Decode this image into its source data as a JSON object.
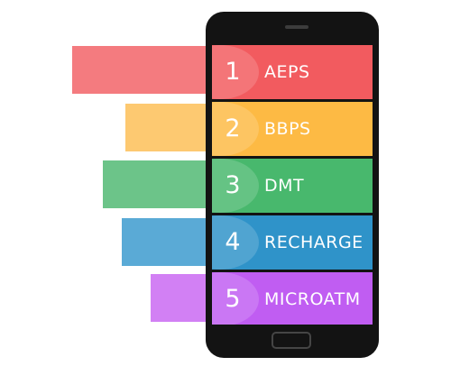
{
  "colors": {
    "aeps": "#f25b5f",
    "bbps": "#fdba44",
    "dmt": "#48b86d",
    "recharge": "#2f93c9",
    "microatm": "#c05df2",
    "phone_body": "#131313"
  },
  "menu": {
    "items": [
      {
        "number": "1",
        "label": "AEPS"
      },
      {
        "number": "2",
        "label": "BBPS"
      },
      {
        "number": "3",
        "label": "DMT"
      },
      {
        "number": "4",
        "label": "RECHARGE"
      },
      {
        "number": "5",
        "label": "MICROATM"
      }
    ]
  },
  "icons": [
    "phone-speaker",
    "home-button"
  ]
}
